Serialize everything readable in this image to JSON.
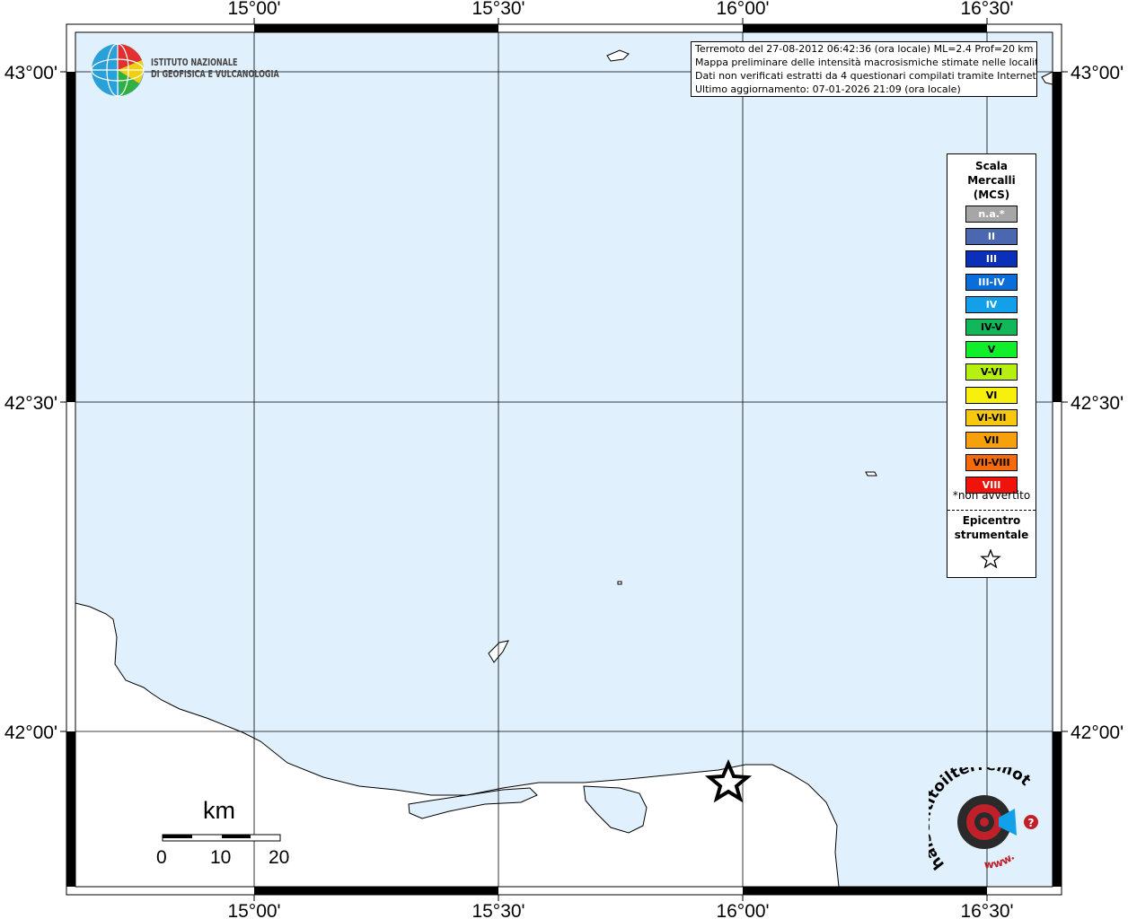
{
  "map": {
    "top_labels": [
      "15°00'",
      "15°30'",
      "16°00'",
      "16°30'"
    ],
    "bottom_labels": [
      "15°00'",
      "15°30'",
      "16°00'",
      "16°30'"
    ],
    "left_labels": [
      "43°00'",
      "42°30'",
      "42°00'"
    ],
    "right_labels": [
      "43°00'",
      "42°30'",
      "42°00'"
    ],
    "sea_color": "#e0f1fd",
    "land_color": "#ffffff"
  },
  "info": {
    "line1": "Terremoto del 27-08-2012 06:42:36 (ora locale) ML=2.4 Prof=20 km",
    "line2": "Mappa preliminare delle intensità macrosismiche stimate nelle località",
    "line3": "Dati non verificati estratti da 4 questionari compilati tramite Internet.",
    "line4": "Ultimo aggiornamento: 07-01-2026 21:09 (ora locale)"
  },
  "logo": {
    "line1": "ISTITUTO NAZIONALE",
    "line2": "DI GEOFISICA E VULCANOLOGIA"
  },
  "legend": {
    "title1": "Scala",
    "title2": "Mercalli",
    "title3": "(MCS)",
    "items": [
      {
        "label": "n.a.*",
        "color": "#a6a6a6"
      },
      {
        "label": "II",
        "color": "#4a67b0"
      },
      {
        "label": "III",
        "color": "#0a2fb8"
      },
      {
        "label": "III-IV",
        "color": "#0b6ed8"
      },
      {
        "label": "IV",
        "color": "#12a0ea"
      },
      {
        "label": "IV-V",
        "color": "#10b85a"
      },
      {
        "label": "V",
        "color": "#12ee2a"
      },
      {
        "label": "V-VI",
        "color": "#b6f010"
      },
      {
        "label": "VI",
        "color": "#f6f00c"
      },
      {
        "label": "VI-VII",
        "color": "#f6c810"
      },
      {
        "label": "VII",
        "color": "#f6a00c"
      },
      {
        "label": "VII-VIII",
        "color": "#f66a0c"
      },
      {
        "label": "VIII",
        "color": "#f0130c"
      }
    ],
    "note": "*non avvertito",
    "epi1": "Epicentro",
    "epi2": "strumentale"
  },
  "scale": {
    "unit": "km",
    "ticks": [
      "0",
      "10",
      "20"
    ]
  },
  "hsit": {
    "text": "haisentitoilterremoto.it",
    "www": "www.",
    "q": "?"
  }
}
